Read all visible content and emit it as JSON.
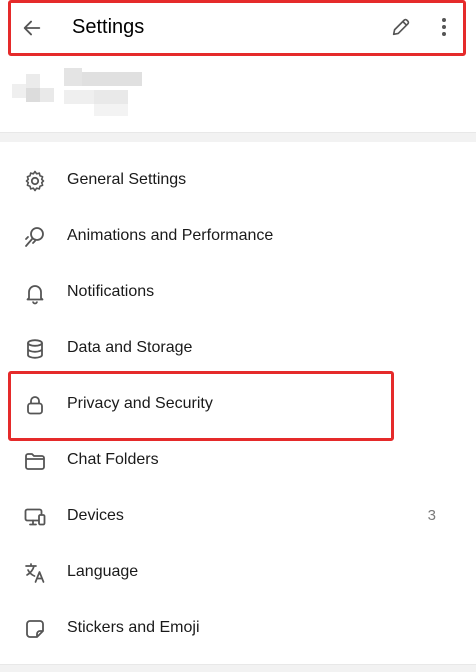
{
  "header": {
    "title": "Settings",
    "back_icon": "arrow-left-icon",
    "edit_icon": "pencil-icon",
    "more_icon": "more-vertical-icon"
  },
  "colors": {
    "highlight": "#e52a2a",
    "icon": "#555555",
    "text": "#1a1a1a",
    "badge": "#7a7a7a"
  },
  "menu": {
    "items": [
      {
        "label": "General Settings",
        "icon": "gear-icon",
        "badge": ""
      },
      {
        "label": "Animations and Performance",
        "icon": "animation-icon",
        "badge": ""
      },
      {
        "label": "Notifications",
        "icon": "bell-icon",
        "badge": ""
      },
      {
        "label": "Data and Storage",
        "icon": "database-icon",
        "badge": ""
      },
      {
        "label": "Privacy and Security",
        "icon": "lock-icon",
        "badge": ""
      },
      {
        "label": "Chat Folders",
        "icon": "folder-icon",
        "badge": ""
      },
      {
        "label": "Devices",
        "icon": "devices-icon",
        "badge": "3"
      },
      {
        "label": "Language",
        "icon": "translate-icon",
        "badge": ""
      },
      {
        "label": "Stickers and Emoji",
        "icon": "sticker-icon",
        "badge": ""
      }
    ]
  }
}
